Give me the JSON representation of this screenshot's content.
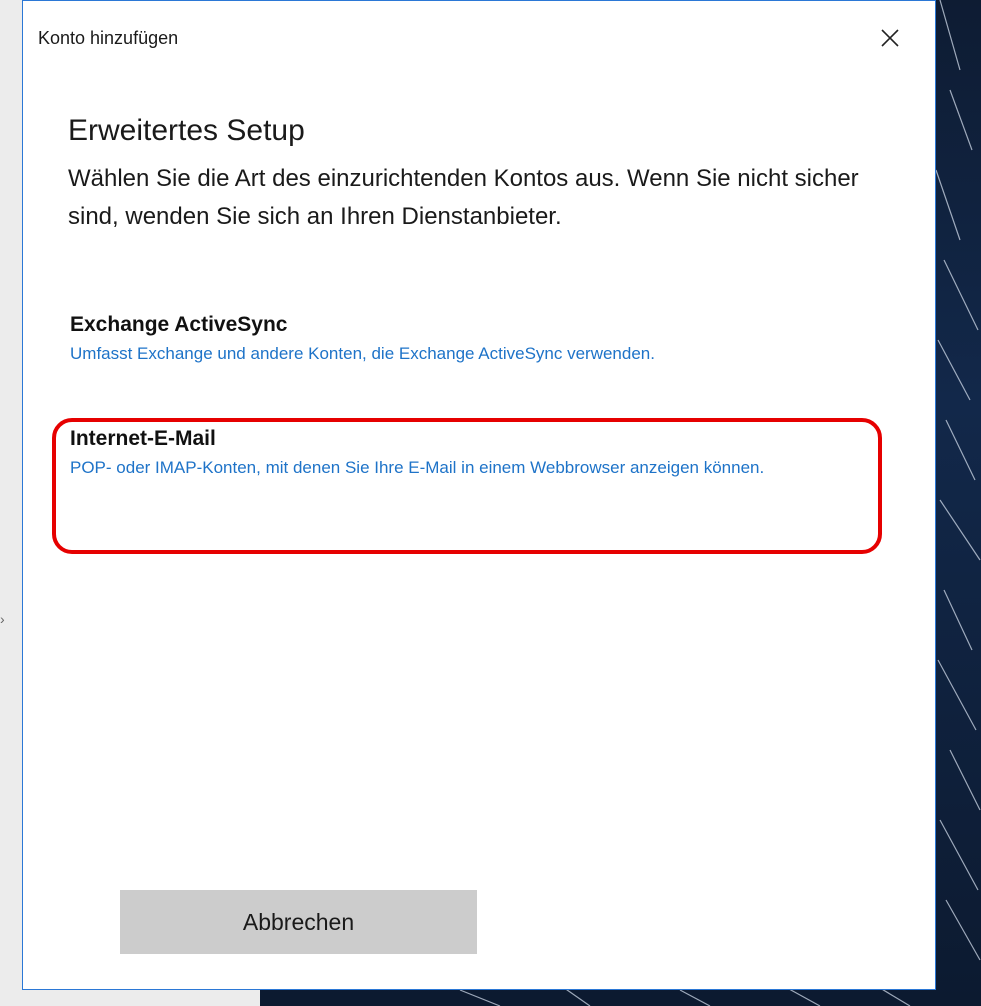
{
  "window": {
    "title": "Konto hinzufügen"
  },
  "content": {
    "heading": "Erweitertes Setup",
    "description": "Wählen Sie die Art des einzurichtenden Kontos aus. Wenn Sie nicht sicher sind, wenden Sie sich an Ihren Dienstanbieter."
  },
  "options": [
    {
      "title": "Exchange ActiveSync",
      "description": "Umfasst Exchange und andere Konten, die Exchange ActiveSync verwenden."
    },
    {
      "title": "Internet-E-Mail",
      "description": "POP- oder IMAP-Konten, mit denen Sie Ihre E-Mail in einem Webbrowser anzeigen können.",
      "highlighted": true
    }
  ],
  "buttons": {
    "cancel_label": "Abbrechen"
  },
  "icons": {
    "close": "close-icon"
  },
  "colors": {
    "link_blue": "#1e73c8",
    "highlight_red": "#e60000",
    "button_grey": "#cccccc",
    "accent_border": "#2b78d6"
  }
}
